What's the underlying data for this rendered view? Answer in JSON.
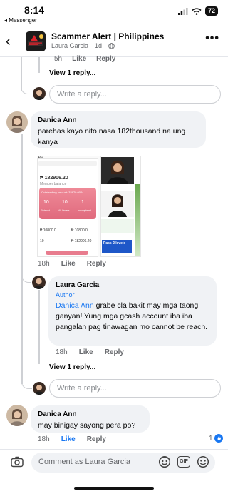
{
  "status": {
    "time": "8:14",
    "back_app": "◂ Messenger",
    "battery": "72"
  },
  "header": {
    "back": "‹",
    "title": "Scammer Alert | Philippines",
    "author": "Laura Garcia",
    "separator": "·",
    "age": "1d",
    "separator2": "·",
    "more": "•••"
  },
  "top_meta": {
    "time": "5h",
    "like": "Like",
    "reply": "Reply"
  },
  "view_replies_1": "View 1 reply...",
  "reply_placeholder": "Write a reply...",
  "comment1": {
    "name": "Danica Ann",
    "text": "parehas  kayo nito nasa 182thousand na ung kanya",
    "time": "18h",
    "like": "Like",
    "reply": "Reply",
    "image": {
      "top_text": ".est.",
      "amount": "₱ 182906.20",
      "balance_label": "Member balance",
      "pink_label": "Outstanding amount: 33870.0024",
      "stats": [
        "10",
        "10",
        "1"
      ],
      "stat_labels": [
        "Finished",
        "All Orders",
        "Incompleted"
      ],
      "row1": [
        "₱ 10800.0",
        "₱ 10800.0"
      ],
      "row2": [
        "10",
        "₱ 182906.20"
      ],
      "stripe": "Pass 2 levels"
    }
  },
  "reply1": {
    "name": "Laura Garcia",
    "tag": "Author",
    "mention": "Danica Ann",
    "text": " grabe cla bakit may mga taong ganyan! Yung mga gcash account iba iba pangalan pag tinawagan mo cannot be reach.",
    "time": "18h",
    "like": "Like",
    "reply": "Reply"
  },
  "view_replies_2": "View 1 reply...",
  "comment2": {
    "name": "Danica Ann",
    "text": "may binigay sayong pera po?",
    "time": "18h",
    "like": "Like",
    "reply": "Reply",
    "reactions": "1"
  },
  "composer": {
    "placeholder": "Comment as Laura Garcia",
    "gif": "GIF"
  },
  "colors": {
    "link": "#1877f2",
    "bubble": "#f0f2f5",
    "muted": "#65676b"
  }
}
